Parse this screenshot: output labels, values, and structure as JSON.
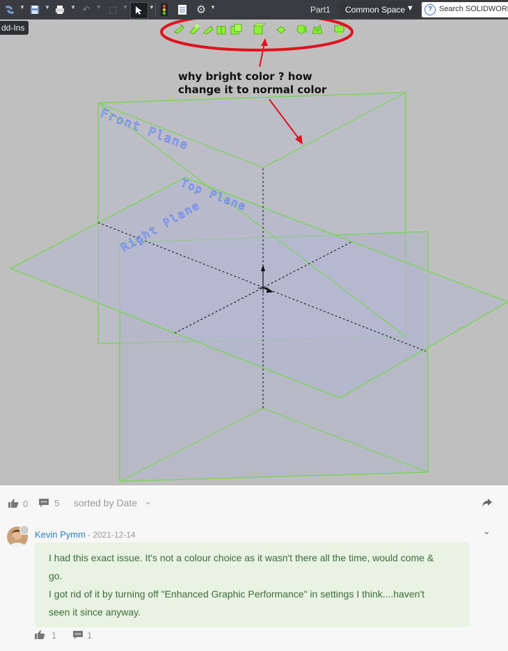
{
  "app": {
    "document_title": "Part1",
    "workspace": "Common Space",
    "search_placeholder": "Search SOLIDWORKS",
    "addins_tab": "dd-Ins",
    "highlight_color": "#8ef03a",
    "plane_edge_color": "#72d84a",
    "plane_label_color": "#6a8ef2",
    "annotation_color": "#e0121e"
  },
  "viewport": {
    "planes": {
      "front": "Front Plane",
      "top": "Top Plane",
      "right": "Right Plane"
    },
    "annotation": {
      "line1": "why bright color ? how",
      "line2": "change it to normal color"
    }
  },
  "toolbar": {
    "icons": [
      "solidworks-logo-icon",
      "save-icon",
      "print-icon",
      "undo-icon",
      "redo-icon",
      "select-arrow-icon",
      "traffic-light-icon",
      "file-properties-icon",
      "gear-icon"
    ],
    "view_icons": [
      "zoom-to-fit-icon",
      "zoom-to-area-icon",
      "previous-view-icon",
      "section-view-icon",
      "view-orientation-icon",
      "display-style-icon",
      "hide-show-items-icon",
      "edit-appearance-icon",
      "apply-scene-icon",
      "view-settings-icon"
    ]
  },
  "forum": {
    "likes": "0",
    "comments": "5",
    "sort_label": "sorted by Date",
    "comment": {
      "author": "Kevin Pymm",
      "date": "- 2021-12-14",
      "lines": [
        "I had this exact issue. It's not a colour choice as it wasn't there all the time, would come &",
        "go.",
        "I got rid of it by turning off \"Enhanced Graphic Performance\" in settings I think....haven't",
        "seen it since anyway."
      ],
      "likes": "1",
      "replies": "1"
    }
  }
}
